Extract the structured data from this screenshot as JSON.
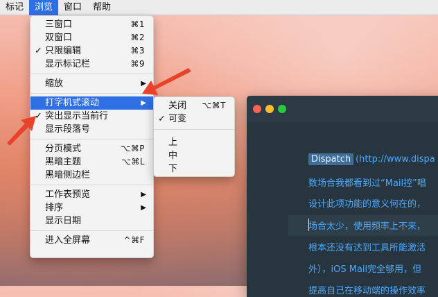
{
  "menubar": {
    "items": [
      {
        "label": "标记"
      },
      {
        "label": "浏览"
      },
      {
        "label": "窗口"
      },
      {
        "label": "帮助"
      }
    ]
  },
  "view_menu": {
    "items": [
      {
        "label": "三窗口",
        "shortcut": "⌘1"
      },
      {
        "label": "双窗口",
        "shortcut": "⌘2"
      },
      {
        "label": "只限编辑",
        "shortcut": "⌘3",
        "check": "✓"
      },
      {
        "label": "显示标记栏",
        "shortcut": "⌘9"
      },
      {
        "label": "缩放",
        "arrow": "▶"
      },
      {
        "label": "打字机式滚动",
        "arrow": "▶"
      },
      {
        "label": "突出显示当前行",
        "check": "✓"
      },
      {
        "label": "显示段落号"
      },
      {
        "label": "分页模式",
        "shortcut": "⌥⌘P"
      },
      {
        "label": "黑暗主题",
        "shortcut": "⌥⌘L"
      },
      {
        "label": "黑暗侧边栏"
      },
      {
        "label": "工作表预览",
        "arrow": "▶"
      },
      {
        "label": "排序",
        "arrow": "▶"
      },
      {
        "label": "显示日期"
      },
      {
        "label": "进入全屏幕",
        "shortcut": "^⌘F"
      }
    ]
  },
  "typewriter_submenu": {
    "items": [
      {
        "label": "关闭",
        "shortcut": "⌥⌘T"
      },
      {
        "label": "可变",
        "check": "✓"
      },
      {
        "label": "上"
      },
      {
        "label": "中"
      },
      {
        "label": "下"
      }
    ]
  },
  "editor": {
    "tag": "Dispatch",
    "lines": [
      "(http://www.dispa",
      "数场合我都看到过“Mail控”唱",
      "设计此项功能的意义何在的，",
      "场合太少，使用频率上不来，",
      "根本还没有达到工具所能激活",
      "外），iOS Mail完全够用，但",
      "提高自己在移动端的操作效率"
    ]
  },
  "colors": {
    "highlight": "#2f6fe4",
    "editor_text": "#4ca9ff",
    "annotation_arrow": "#e8432a"
  }
}
